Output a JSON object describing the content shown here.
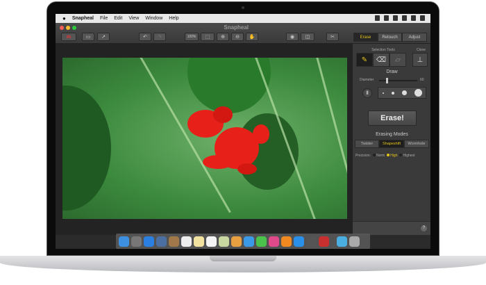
{
  "menubar": {
    "app": "Snapheal",
    "items": [
      "File",
      "Edit",
      "View",
      "Window",
      "Help"
    ]
  },
  "window": {
    "title": "Snapheal"
  },
  "toolbar": {
    "zoom_label": "100%",
    "modes": [
      "Erase",
      "Retouch",
      "Adjust"
    ],
    "active_mode": "Erase"
  },
  "panel": {
    "selection_tools_label": "Selection Tools",
    "clone_label": "Clone",
    "draw_label": "Draw",
    "diameter_label": "Diameter",
    "diameter_value": "60",
    "diameter_fraction": 0.2,
    "erase_button": "Erase!",
    "erasing_modes_label": "Erasing Modes",
    "erasing_modes": [
      "Twister",
      "Shapeshift",
      "Wormhole"
    ],
    "active_erasing_mode": "Shapeshift",
    "precision_label": "Precision:",
    "precision_options": [
      "Norm",
      "High",
      "Highest"
    ],
    "active_precision": "High",
    "help": "?"
  },
  "dock": {
    "colors": [
      "#3d8fe0",
      "#777",
      "#2a7fe0",
      "#4a6fa0",
      "#a0784a",
      "#eee",
      "#f2e2a0",
      "#f4f4f4",
      "#c9d8a0",
      "#e8a040",
      "#3a9ae8",
      "#4bc24b",
      "#e04a8a",
      "#f08a20",
      "#2a8fe8",
      "#555",
      "#c83030",
      "#4aaee0",
      "#aaa"
    ]
  },
  "colors": {
    "accent": "#e6c419",
    "frog": "#e8201a"
  }
}
